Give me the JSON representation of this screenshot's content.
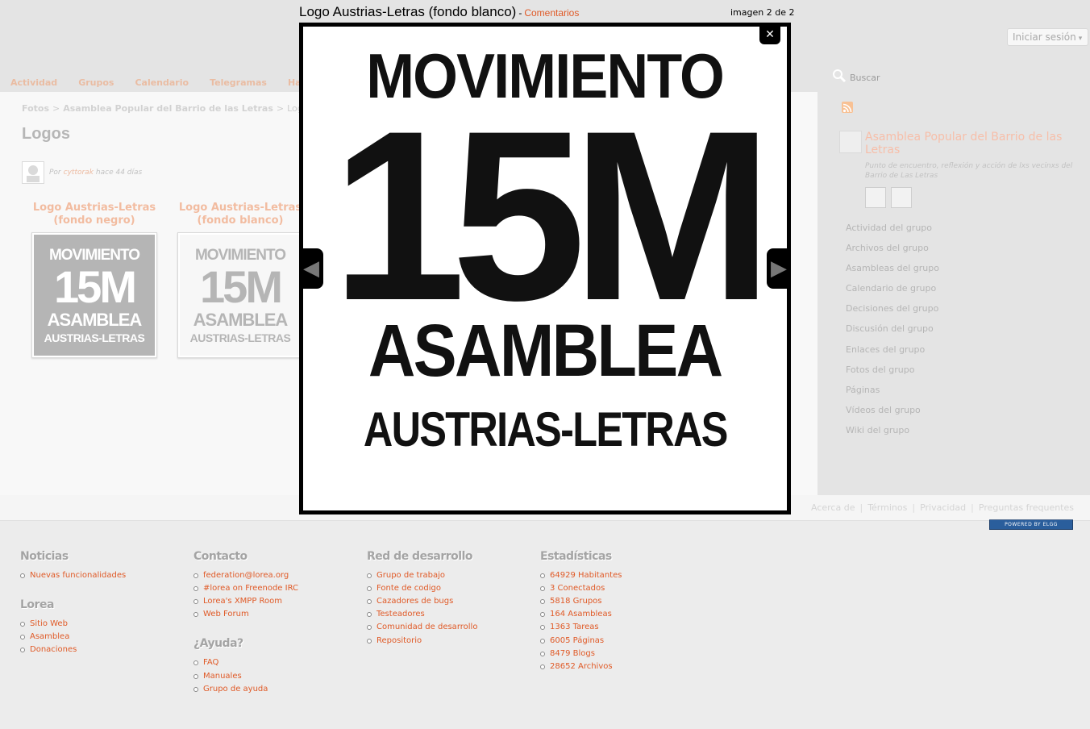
{
  "header": {
    "login_label": "Iniciar sesión",
    "login_arrow": "▾",
    "nav": [
      "Actividad",
      "Grupos",
      "Calendario",
      "Telegramas",
      "Habit"
    ],
    "search_placeholder": "Buscar",
    "search_icon": "search-icon"
  },
  "breadcrumb": {
    "items": [
      "Fotos",
      "Asamblea Popular del Barrio de las Letras",
      "Logos"
    ],
    "separator": ">"
  },
  "page": {
    "title": "Logos",
    "byline_prefix": "Por",
    "author": "cyttorak",
    "time": "hace 44 días"
  },
  "gallery": [
    {
      "caption": "Logo Austrias-Letras (fondo negro)",
      "lines": [
        "MOVIMIENTO",
        "15M",
        "ASAMBLEA",
        "AUSTRIAS-LETRAS"
      ]
    },
    {
      "caption": "Logo Austrias-Letras (fondo blanco)",
      "lines": [
        "MOVIMIENTO",
        "15M",
        "ASAMBLEA",
        "AUSTRIAS-LETRAS"
      ]
    }
  ],
  "sidebar": {
    "rss_icon": "rss-icon",
    "group_name": "Asamblea Popular del Barrio de las Letras",
    "group_description": "Punto de encuentro, reflexión y acción de lxs vecinxs del Barrio de Las Letras",
    "menu": [
      "Actividad del grupo",
      "Archivos del grupo",
      "Asambleas del grupo",
      "Calendario de grupo",
      "Decisiones del grupo",
      "Discusión del grupo",
      "Enlaces del grupo",
      "Fotos del grupo",
      "Páginas",
      "Vídeos del grupo",
      "Wiki del grupo"
    ]
  },
  "footer_links": [
    "Acerca de",
    "Términos",
    "Privacidad",
    "Preguntas frequentes"
  ],
  "powered_by": "POWERED BY ELGG",
  "footer_columns": [
    {
      "heading": "Noticias",
      "items": [
        "Nuevas funcionalidades"
      ]
    },
    {
      "heading": "Lorea",
      "items": [
        "Sitio Web",
        "Asamblea",
        "Donaciones"
      ]
    },
    {
      "heading": "Contacto",
      "items": [
        "federation@lorea.org",
        "#lorea on Freenode IRC",
        "Lorea's XMPP Room",
        "Web Forum"
      ]
    },
    {
      "heading": "¿Ayuda?",
      "items": [
        "FAQ",
        "Manuales",
        "Grupo de ayuda"
      ]
    },
    {
      "heading": "Red de desarrollo",
      "items": [
        "Grupo de trabajo",
        "Fonte de codigo",
        "Cazadores de bugs",
        "Testeadores",
        "Comunidad de desarrollo",
        "Repositorio"
      ]
    },
    {
      "heading": "Estadísticas",
      "items": [
        "64929 Habitantes",
        "3 Conectados",
        "5818 Grupos",
        "164 Asambleas",
        "1363 Tareas",
        "6005 Páginas",
        "8479 Blogs",
        "28652 Archivos"
      ]
    }
  ],
  "lightbox": {
    "title": "Logo Austrias-Letras (fondo blanco)",
    "separator": "-",
    "comments_label": "Comentarios",
    "counter": "imagen 2 de 2",
    "close_glyph": "✕",
    "prev_glyph": "◀",
    "next_glyph": "▶",
    "image_lines": [
      "MOVIMIENTO",
      "15M",
      "ASAMBLEA",
      "AUSTRIAS-LETRAS"
    ]
  }
}
